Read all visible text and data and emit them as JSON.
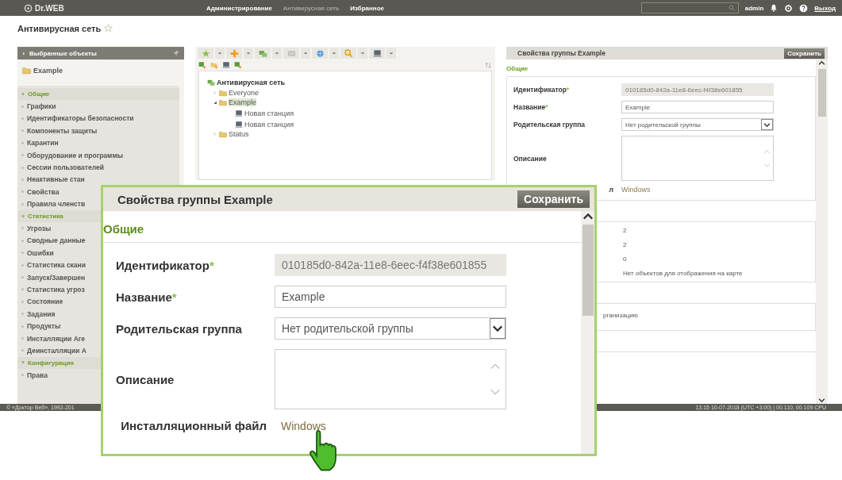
{
  "topbar": {
    "logo": "Dr.WEB",
    "nav": [
      {
        "label": "Администрирование",
        "selected": false
      },
      {
        "label": "Антивирусная сеть",
        "selected": true
      },
      {
        "label": "Избранное",
        "selected": false
      }
    ],
    "user": "admin",
    "logout": "Выход"
  },
  "page_title": "Антивирусная сеть",
  "sidebar": {
    "header": "Выбранные объекты",
    "favorites": [
      "Example"
    ],
    "groups": [
      {
        "title": "Общие",
        "expanded": true,
        "items": [
          "Графики",
          "Идентификаторы безопасности",
          "Компоненты защиты",
          "Карантин",
          "Оборудование и программы",
          "Сессии пользователей",
          "Неактивные стан",
          "Свойства",
          "Правила членств"
        ]
      },
      {
        "title": "Статистика",
        "expanded": true,
        "items": [
          "Угрозы",
          "Сводные данные",
          "Ошибки",
          "Статистика скани",
          "Запуск/Завершен",
          "Статистика угроз",
          "Состояние",
          "Задания",
          "Продукты",
          "Инсталляции Аге",
          "Деинсталляции А"
        ]
      },
      {
        "title": "Конфигурация",
        "expanded": true,
        "items": [
          "Права"
        ]
      }
    ]
  },
  "tree": [
    {
      "label": "Антивирусная сеть",
      "kind": "network",
      "selected": false,
      "children": [
        {
          "label": "Everyone",
          "kind": "group",
          "expanded": false,
          "selected": false
        },
        {
          "label": "Example",
          "kind": "group",
          "expanded": true,
          "selected": true,
          "children": [
            {
              "label": "Новая станция",
              "kind": "station",
              "selected": false
            },
            {
              "label": "Новая станция",
              "kind": "station",
              "selected": false
            }
          ]
        },
        {
          "label": "Status",
          "kind": "group",
          "expanded": false,
          "selected": false
        }
      ]
    }
  ],
  "properties_panel": {
    "title": "Свойства группы Example",
    "save": "Сохранить",
    "section": "Общие",
    "fields": [
      {
        "label": "Идентификатор",
        "required_mark": "*",
        "kind": "readonly",
        "value": "010185d0-842a-11e8-6eec-f4f38e601855"
      },
      {
        "label": "Название",
        "required_mark": "*",
        "kind": "text",
        "value": "Example"
      },
      {
        "label": "Родительская группа",
        "kind": "select",
        "value": "Нет родительской группы"
      },
      {
        "label": "Описание",
        "kind": "textarea"
      },
      {
        "label": "л",
        "kind": "link",
        "value": "Windows"
      }
    ],
    "stats": [
      "2",
      "2",
      "0",
      "Нет объектов для отображения на карте"
    ],
    "note": "рганизацию"
  },
  "callout": {
    "title": "Свойства группы Example",
    "save": "Сохранить",
    "section": "Общие",
    "fields": [
      {
        "label": "Идентификатор",
        "required_mark": "*",
        "kind": "readonly",
        "value": "010185d0-842a-11e8-6eec-f4f38e601855"
      },
      {
        "label": "Название",
        "required_mark": "*",
        "kind": "text",
        "value": "Example"
      },
      {
        "label": "Родительская группа",
        "kind": "select",
        "value": "Нет родительской группы"
      },
      {
        "label": "Описание",
        "kind": "textarea"
      },
      {
        "label": "Инсталляционный файл",
        "kind": "link",
        "value": "Windows"
      }
    ]
  },
  "footer": {
    "copyright": "© «Доктор Веб», 1992-201",
    "status": "13:15 10-07-2018 (UTC +3:00) | 00.110, 00.109 CPU"
  }
}
